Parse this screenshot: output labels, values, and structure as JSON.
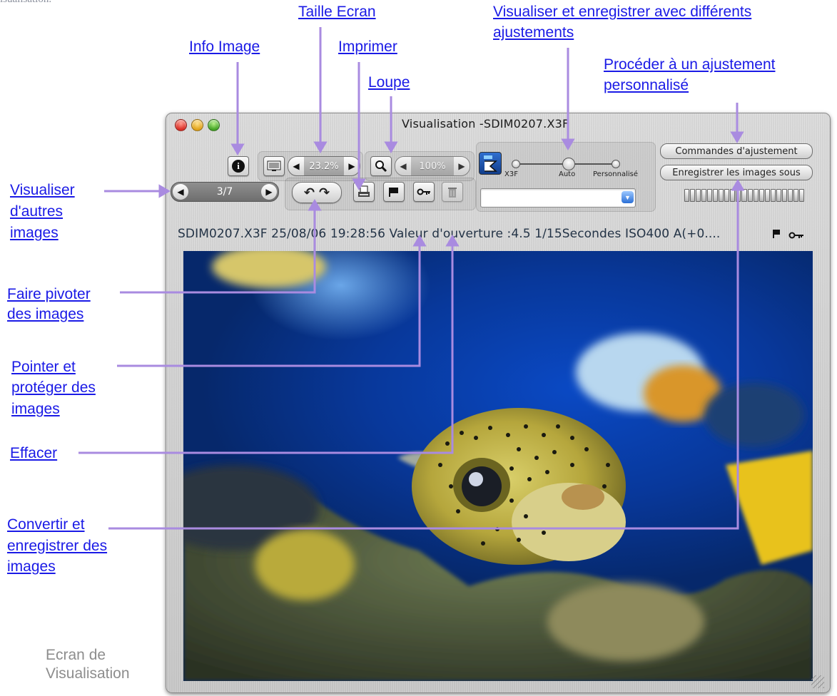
{
  "header_cut": "isualisation.",
  "annotations": {
    "taille_ecran": "Taille Ecran",
    "visualiser_line1": "Visualiser et enregistrer avec différents",
    "visualiser_line2": "ajustements",
    "info_image": "Info Image",
    "imprimer": "Imprimer",
    "loupe": "Loupe",
    "proceder_line1": "Procéder à un ajustement",
    "proceder_line2": "personnalisé",
    "autres_line1": "Visualiser",
    "autres_line2": "d'autres",
    "autres_line3": "images",
    "pivoter_line1": "Faire pivoter",
    "pivoter_line2": "des images",
    "pointer_line1": "Pointer et",
    "pointer_line2": "protéger des",
    "pointer_line3": "images",
    "effacer": "Effacer",
    "convertir_line1": "Convertir et",
    "convertir_line2": "enregistrer des",
    "convertir_line3": "images"
  },
  "caption": {
    "line1": "Ecran de",
    "line2": "Visualisation"
  },
  "window": {
    "title": "Visualisation -SDIM0207.X3F",
    "zoom_screen": "23.2%",
    "zoom_loupe": "100%",
    "nav_counter": "3/7",
    "slider_labels": {
      "x3f": "X3F",
      "auto": "Auto",
      "perso": "Personnalisé"
    },
    "btn_commands": "Commandes d'ajustement",
    "btn_save": "Enregistrer les images sous",
    "info_bar": "SDIM0207.X3F 25/08/06 19:28:56 Valeur d'ouverture :4.5 1/15Secondes ISO400 A(+0...."
  },
  "colors": {
    "annotation_link": "#1a1ae6",
    "connector": "#a98be0",
    "caption": "#8d8d8d"
  },
  "icons": [
    "info-icon",
    "monitor-icon",
    "magnifier-icon",
    "sigma-x3f-icon",
    "rotate-left-icon",
    "rotate-right-icon",
    "print-icon",
    "flag-icon",
    "key-icon",
    "trash-icon",
    "flag-small-icon",
    "key-small-icon"
  ]
}
